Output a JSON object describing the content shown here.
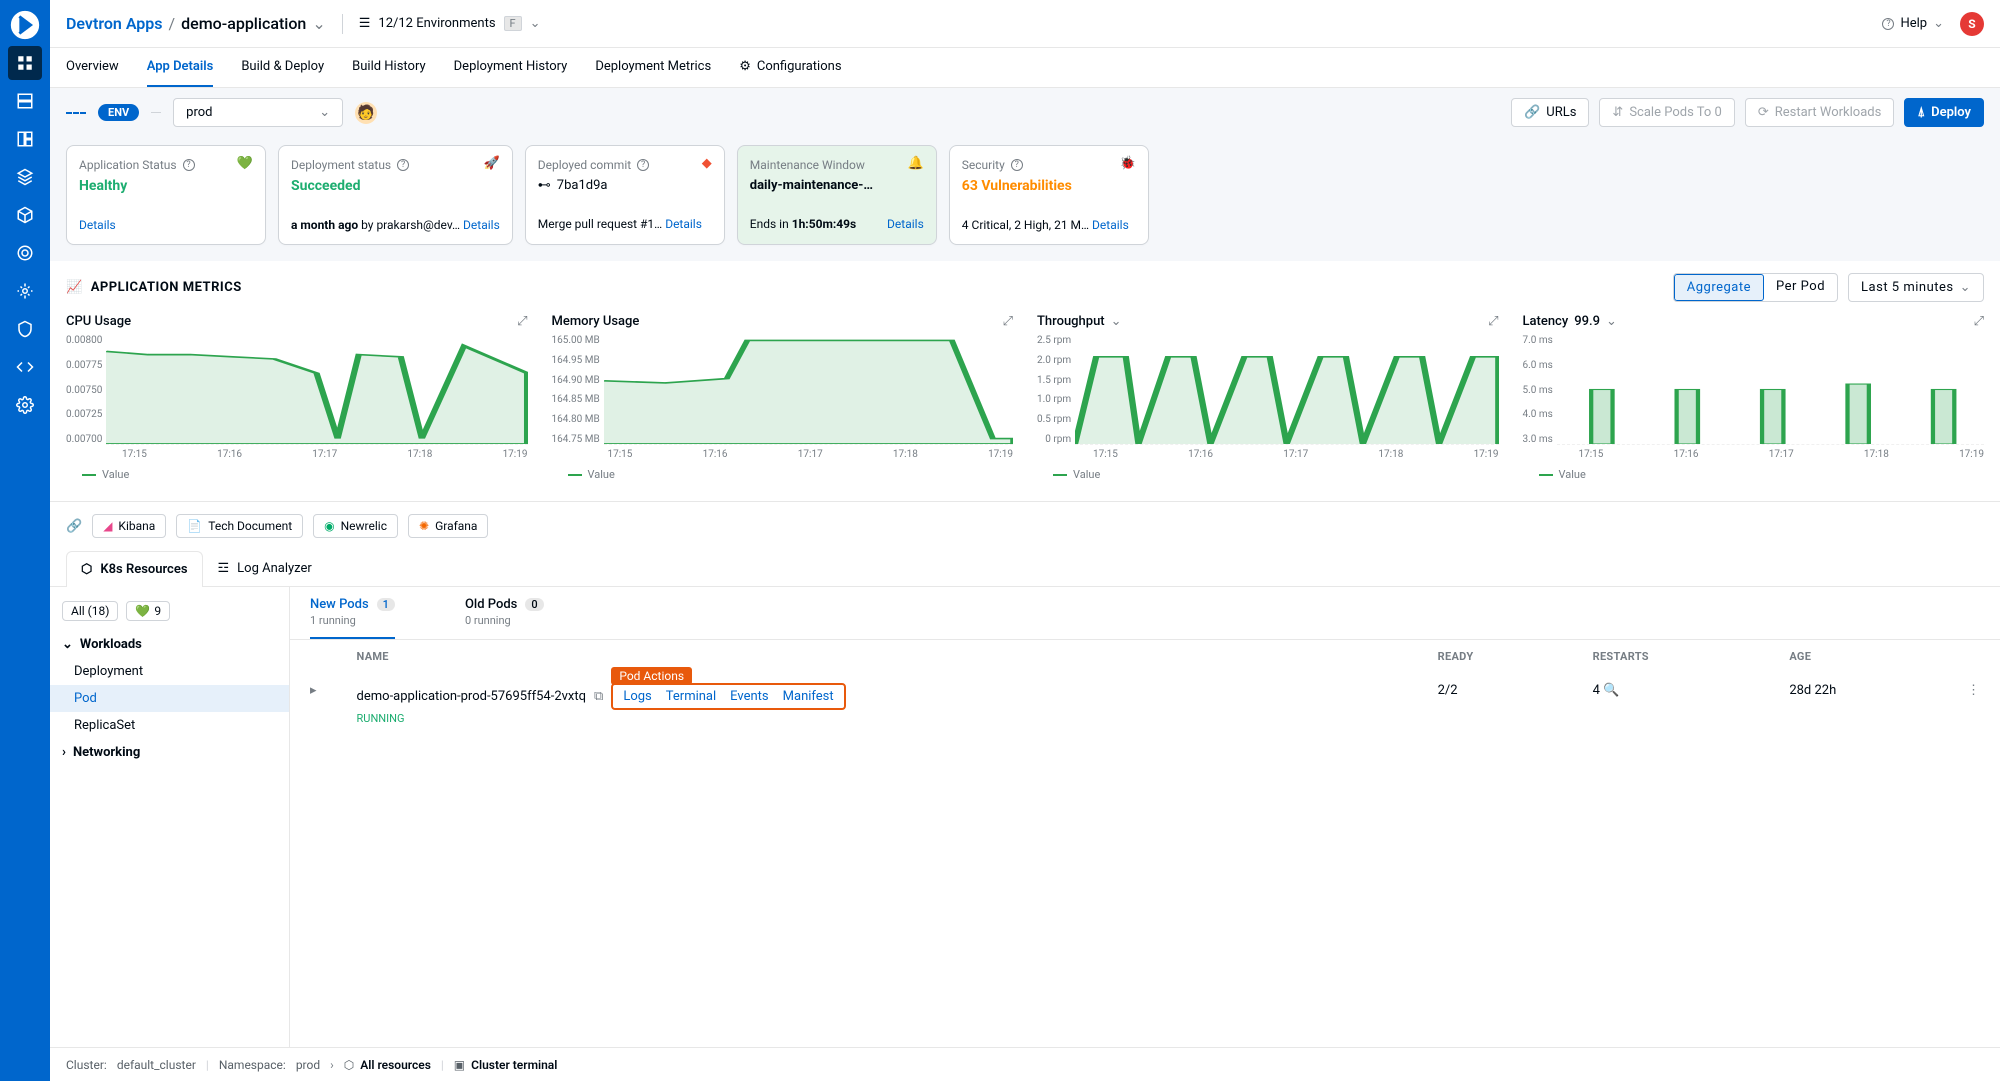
{
  "breadcrumb": {
    "root": "Devtron Apps",
    "sep": "/",
    "app": "demo-application"
  },
  "envFilter": {
    "text": "12/12 Environments",
    "kbd": "F"
  },
  "help": {
    "label": "Help"
  },
  "avatar": "S",
  "tabs": [
    "Overview",
    "App Details",
    "Build & Deploy",
    "Build History",
    "Deployment History",
    "Deployment Metrics",
    "Configurations"
  ],
  "envBar": {
    "badge": "ENV",
    "selected": "prod"
  },
  "actions": {
    "urls": "URLs",
    "scale": "Scale Pods To 0",
    "restart": "Restart Workloads",
    "deploy": "Deploy"
  },
  "cards": {
    "appStatus": {
      "title": "Application Status",
      "value": "Healthy",
      "details": "Details"
    },
    "deployStatus": {
      "title": "Deployment status",
      "value": "Succeeded",
      "footer_time": "a month ago",
      "footer_by": "by prakarsh@dev…",
      "details": "Details"
    },
    "commit": {
      "title": "Deployed commit",
      "hash": "7ba1d9a",
      "footer": "Merge pull request #1…",
      "details": "Details"
    },
    "maint": {
      "title": "Maintenance Window",
      "value": "daily-maintenance-…",
      "footer_prefix": "Ends in",
      "footer_time": "1h:50m:49s",
      "details": "Details"
    },
    "security": {
      "title": "Security",
      "value": "63 Vulnerabilities",
      "footer": "4 Critical, 2 High, 21 M…",
      "details": "Details"
    }
  },
  "metrics": {
    "title": "APPLICATION METRICS",
    "aggregate": "Aggregate",
    "perpod": "Per Pod",
    "range": "Last 5 minutes",
    "legend": "Value"
  },
  "charts": {
    "cpu": {
      "title": "CPU Usage",
      "yticks": [
        "0.00800",
        "0.00775",
        "0.00750",
        "0.00725",
        "0.00700"
      ],
      "xticks": [
        "17:15",
        "17:16",
        "17:17",
        "17:18",
        "17:19"
      ]
    },
    "mem": {
      "title": "Memory Usage",
      "yticks": [
        "165.00 MB",
        "164.95 MB",
        "164.90 MB",
        "164.85 MB",
        "164.80 MB",
        "164.75 MB"
      ],
      "xticks": [
        "17:15",
        "17:16",
        "17:17",
        "17:18",
        "17:19"
      ]
    },
    "thr": {
      "title": "Throughput",
      "yticks": [
        "2.5 rpm",
        "2.0 rpm",
        "1.5 rpm",
        "1.0 rpm",
        "0.5 rpm",
        "0 rpm"
      ],
      "xticks": [
        "17:15",
        "17:16",
        "17:17",
        "17:18",
        "17:19"
      ]
    },
    "lat": {
      "title": "Latency",
      "percentile": "99.9",
      "yticks": [
        "7.0 ms",
        "6.0 ms",
        "5.0 ms",
        "4.0 ms",
        "3.0 ms"
      ],
      "xticks": [
        "17:15",
        "17:16",
        "17:17",
        "17:18",
        "17:19"
      ]
    }
  },
  "extLinks": [
    "Kibana",
    "Tech Document",
    "Newrelic",
    "Grafana"
  ],
  "resTabs": {
    "k8s": "K8s Resources",
    "log": "Log Analyzer"
  },
  "tree": {
    "all": "All (18)",
    "health": "9",
    "groups": [
      {
        "label": "Workloads",
        "open": true,
        "items": [
          "Deployment",
          "Pod",
          "ReplicaSet"
        ]
      },
      {
        "label": "Networking",
        "open": false,
        "items": []
      }
    ]
  },
  "podsTabs": {
    "new": {
      "label": "New Pods",
      "count": "1",
      "sub": "1 running"
    },
    "old": {
      "label": "Old Pods",
      "count": "0",
      "sub": "0 running"
    }
  },
  "tableHeaders": {
    "name": "NAME",
    "ready": "READY",
    "restarts": "RESTARTS",
    "age": "AGE"
  },
  "podRow": {
    "name": "demo-application-prod-57695ff54-2vxtq",
    "status": "RUNNING",
    "ready": "2/2",
    "restarts": "4",
    "age": "28d 22h"
  },
  "podActions": {
    "label": "Pod Actions",
    "logs": "Logs",
    "terminal": "Terminal",
    "events": "Events",
    "manifest": "Manifest"
  },
  "footer": {
    "cluster_label": "Cluster:",
    "cluster": "default_cluster",
    "ns_label": "Namespace:",
    "ns": "prod",
    "all": "All resources",
    "term": "Cluster terminal"
  },
  "chart_data": [
    {
      "type": "line",
      "title": "CPU Usage",
      "x": [
        "17:15",
        "17:16",
        "17:17",
        "17:18",
        "17:19"
      ],
      "ylim": [
        0.007,
        0.008
      ],
      "series": [
        {
          "name": "Value",
          "values": [
            0.0079,
            0.00785,
            0.00785,
            0.0078,
            0.00775,
            0.0076,
            0.007,
            0.00785,
            0.0078,
            0.007,
            0.0079
          ]
        }
      ],
      "legend_position": "bottom"
    },
    {
      "type": "line",
      "title": "Memory Usage",
      "x": [
        "17:15",
        "17:16",
        "17:17",
        "17:18",
        "17:19"
      ],
      "ylim": [
        164.75,
        165.0
      ],
      "series": [
        {
          "name": "Value",
          "values": [
            164.9,
            164.89,
            164.9,
            165.0,
            165.0,
            165.0,
            165.0,
            165.0,
            165.0,
            164.75
          ]
        }
      ],
      "legend_position": "bottom"
    },
    {
      "type": "line",
      "title": "Throughput",
      "x": [
        "17:15",
        "17:16",
        "17:17",
        "17:18",
        "17:19"
      ],
      "ylim": [
        0,
        2.5
      ],
      "series": [
        {
          "name": "Value",
          "values": [
            0,
            2.0,
            0,
            2.0,
            0,
            2.0,
            0,
            2.0,
            0,
            2.0,
            0,
            2.0
          ]
        }
      ],
      "unit": "rpm",
      "legend_position": "bottom"
    },
    {
      "type": "bar",
      "title": "Latency 99.9",
      "x": [
        "17:15",
        "17:16",
        "17:17",
        "17:18",
        "17:19"
      ],
      "ylim": [
        3.0,
        7.0
      ],
      "series": [
        {
          "name": "Value",
          "values": [
            5.0,
            5.0,
            5.0,
            5.2,
            5.0
          ]
        }
      ],
      "unit": "ms",
      "legend_position": "bottom"
    }
  ]
}
